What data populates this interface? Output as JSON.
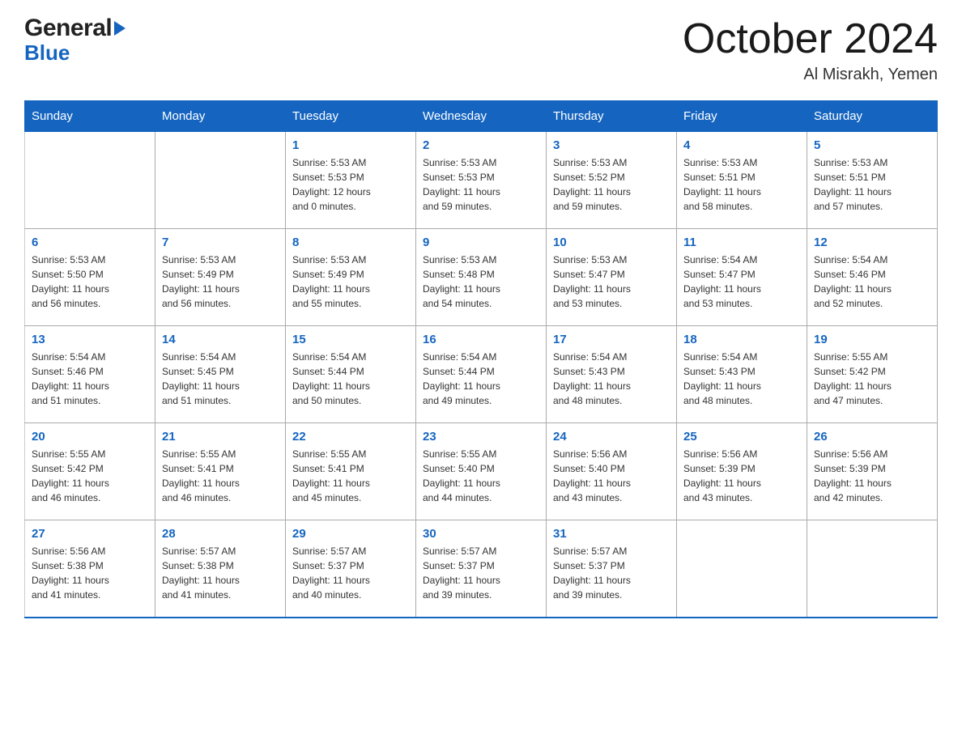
{
  "logo": {
    "line1": "General",
    "line2": "Blue"
  },
  "title": "October 2024",
  "location": "Al Misrakh, Yemen",
  "days_header": [
    "Sunday",
    "Monday",
    "Tuesday",
    "Wednesday",
    "Thursday",
    "Friday",
    "Saturday"
  ],
  "weeks": [
    [
      {
        "num": "",
        "info": ""
      },
      {
        "num": "",
        "info": ""
      },
      {
        "num": "1",
        "info": "Sunrise: 5:53 AM\nSunset: 5:53 PM\nDaylight: 12 hours\nand 0 minutes."
      },
      {
        "num": "2",
        "info": "Sunrise: 5:53 AM\nSunset: 5:53 PM\nDaylight: 11 hours\nand 59 minutes."
      },
      {
        "num": "3",
        "info": "Sunrise: 5:53 AM\nSunset: 5:52 PM\nDaylight: 11 hours\nand 59 minutes."
      },
      {
        "num": "4",
        "info": "Sunrise: 5:53 AM\nSunset: 5:51 PM\nDaylight: 11 hours\nand 58 minutes."
      },
      {
        "num": "5",
        "info": "Sunrise: 5:53 AM\nSunset: 5:51 PM\nDaylight: 11 hours\nand 57 minutes."
      }
    ],
    [
      {
        "num": "6",
        "info": "Sunrise: 5:53 AM\nSunset: 5:50 PM\nDaylight: 11 hours\nand 56 minutes."
      },
      {
        "num": "7",
        "info": "Sunrise: 5:53 AM\nSunset: 5:49 PM\nDaylight: 11 hours\nand 56 minutes."
      },
      {
        "num": "8",
        "info": "Sunrise: 5:53 AM\nSunset: 5:49 PM\nDaylight: 11 hours\nand 55 minutes."
      },
      {
        "num": "9",
        "info": "Sunrise: 5:53 AM\nSunset: 5:48 PM\nDaylight: 11 hours\nand 54 minutes."
      },
      {
        "num": "10",
        "info": "Sunrise: 5:53 AM\nSunset: 5:47 PM\nDaylight: 11 hours\nand 53 minutes."
      },
      {
        "num": "11",
        "info": "Sunrise: 5:54 AM\nSunset: 5:47 PM\nDaylight: 11 hours\nand 53 minutes."
      },
      {
        "num": "12",
        "info": "Sunrise: 5:54 AM\nSunset: 5:46 PM\nDaylight: 11 hours\nand 52 minutes."
      }
    ],
    [
      {
        "num": "13",
        "info": "Sunrise: 5:54 AM\nSunset: 5:46 PM\nDaylight: 11 hours\nand 51 minutes."
      },
      {
        "num": "14",
        "info": "Sunrise: 5:54 AM\nSunset: 5:45 PM\nDaylight: 11 hours\nand 51 minutes."
      },
      {
        "num": "15",
        "info": "Sunrise: 5:54 AM\nSunset: 5:44 PM\nDaylight: 11 hours\nand 50 minutes."
      },
      {
        "num": "16",
        "info": "Sunrise: 5:54 AM\nSunset: 5:44 PM\nDaylight: 11 hours\nand 49 minutes."
      },
      {
        "num": "17",
        "info": "Sunrise: 5:54 AM\nSunset: 5:43 PM\nDaylight: 11 hours\nand 48 minutes."
      },
      {
        "num": "18",
        "info": "Sunrise: 5:54 AM\nSunset: 5:43 PM\nDaylight: 11 hours\nand 48 minutes."
      },
      {
        "num": "19",
        "info": "Sunrise: 5:55 AM\nSunset: 5:42 PM\nDaylight: 11 hours\nand 47 minutes."
      }
    ],
    [
      {
        "num": "20",
        "info": "Sunrise: 5:55 AM\nSunset: 5:42 PM\nDaylight: 11 hours\nand 46 minutes."
      },
      {
        "num": "21",
        "info": "Sunrise: 5:55 AM\nSunset: 5:41 PM\nDaylight: 11 hours\nand 46 minutes."
      },
      {
        "num": "22",
        "info": "Sunrise: 5:55 AM\nSunset: 5:41 PM\nDaylight: 11 hours\nand 45 minutes."
      },
      {
        "num": "23",
        "info": "Sunrise: 5:55 AM\nSunset: 5:40 PM\nDaylight: 11 hours\nand 44 minutes."
      },
      {
        "num": "24",
        "info": "Sunrise: 5:56 AM\nSunset: 5:40 PM\nDaylight: 11 hours\nand 43 minutes."
      },
      {
        "num": "25",
        "info": "Sunrise: 5:56 AM\nSunset: 5:39 PM\nDaylight: 11 hours\nand 43 minutes."
      },
      {
        "num": "26",
        "info": "Sunrise: 5:56 AM\nSunset: 5:39 PM\nDaylight: 11 hours\nand 42 minutes."
      }
    ],
    [
      {
        "num": "27",
        "info": "Sunrise: 5:56 AM\nSunset: 5:38 PM\nDaylight: 11 hours\nand 41 minutes."
      },
      {
        "num": "28",
        "info": "Sunrise: 5:57 AM\nSunset: 5:38 PM\nDaylight: 11 hours\nand 41 minutes."
      },
      {
        "num": "29",
        "info": "Sunrise: 5:57 AM\nSunset: 5:37 PM\nDaylight: 11 hours\nand 40 minutes."
      },
      {
        "num": "30",
        "info": "Sunrise: 5:57 AM\nSunset: 5:37 PM\nDaylight: 11 hours\nand 39 minutes."
      },
      {
        "num": "31",
        "info": "Sunrise: 5:57 AM\nSunset: 5:37 PM\nDaylight: 11 hours\nand 39 minutes."
      },
      {
        "num": "",
        "info": ""
      },
      {
        "num": "",
        "info": ""
      }
    ]
  ]
}
